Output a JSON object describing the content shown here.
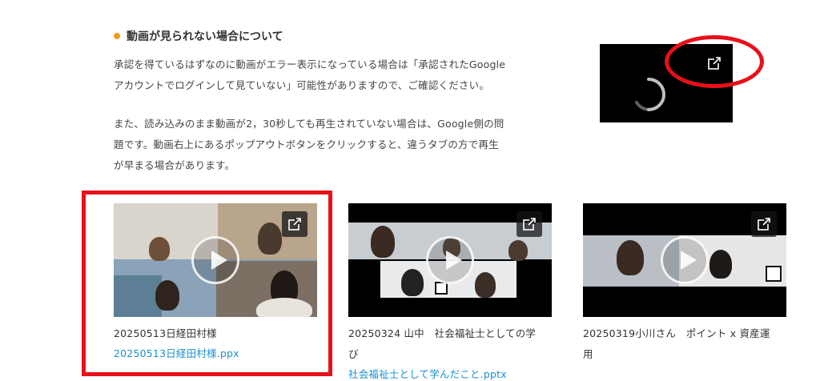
{
  "notice": {
    "heading": "動画が見られない場合について",
    "para1_line1": "承認を得ているはずなのに動画がエラー表示になっている場合は「承認されたGoogle",
    "para1_line2": "アカウントでログインして見ていない」可能性がありますので、ご確認ください。",
    "para2_line1": "また、読み込みのまま動画が2，30秒しても再生されていない場合は、Google側の問",
    "para2_line2": "題です。動画右上にあるポップアウトボタンをクリックすると、違うタブの方で再生",
    "para2_line3": "が早まる場合があります。"
  },
  "colors": {
    "accent_bullet": "#f39a1e",
    "highlight_red": "#e8101a",
    "link_blue": "#1a8fd1"
  },
  "icons": [
    "loading-spinner-icon",
    "popout-icon",
    "play-icon"
  ],
  "videos": [
    {
      "title": "20250513日経田村様",
      "link": "20250513日経田村様.ppx"
    },
    {
      "title_line1": "20250324 山中　社会福祉士としての学",
      "title_line2": "び",
      "link": "社会福祉士として学んだこと.pptx"
    },
    {
      "title_line1": "20250319小川さん　ポイント x 資産運",
      "title_line2": "用"
    }
  ]
}
